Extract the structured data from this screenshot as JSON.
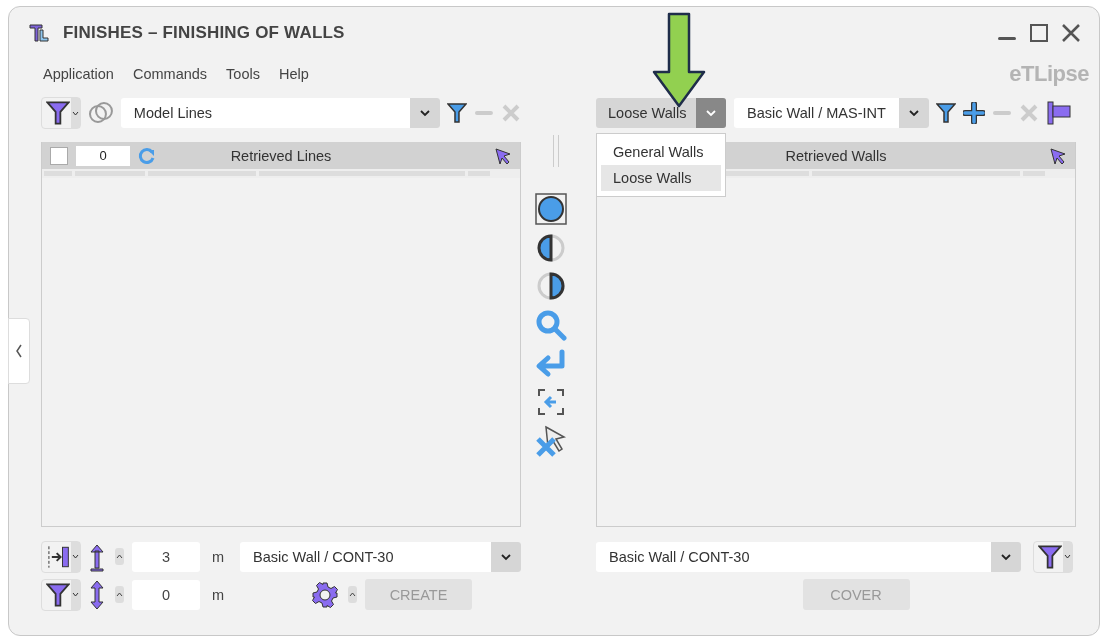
{
  "window": {
    "title": "FINISHES – FINISHING OF WALLS",
    "brand": "eTLipse"
  },
  "menu": [
    "Application",
    "Commands",
    "Tools",
    "Help"
  ],
  "left": {
    "source": {
      "value": "Model Lines"
    },
    "header": {
      "checked": false,
      "count": "0",
      "title": "Retrieved Lines"
    }
  },
  "right": {
    "category": {
      "value": "Loose Walls",
      "expanded": true,
      "options": [
        {
          "label": "General Walls",
          "selected": false
        },
        {
          "label": "Loose Walls",
          "selected": true
        }
      ]
    },
    "type_field": {
      "value": "Basic Wall / MAS-INT"
    },
    "header": {
      "title": "Retrieved Walls"
    }
  },
  "bottom_left": {
    "height": {
      "value": "3",
      "unit": "m"
    },
    "offset": {
      "value": "0",
      "unit": "m"
    },
    "wall_type": "Basic Wall / CONT-30",
    "create_button": {
      "label": "CREATE",
      "disabled": true
    }
  },
  "bottom_right": {
    "wall_type": "Basic Wall / CONT-30",
    "cover_button": {
      "label": "COVER",
      "disabled": true
    }
  }
}
